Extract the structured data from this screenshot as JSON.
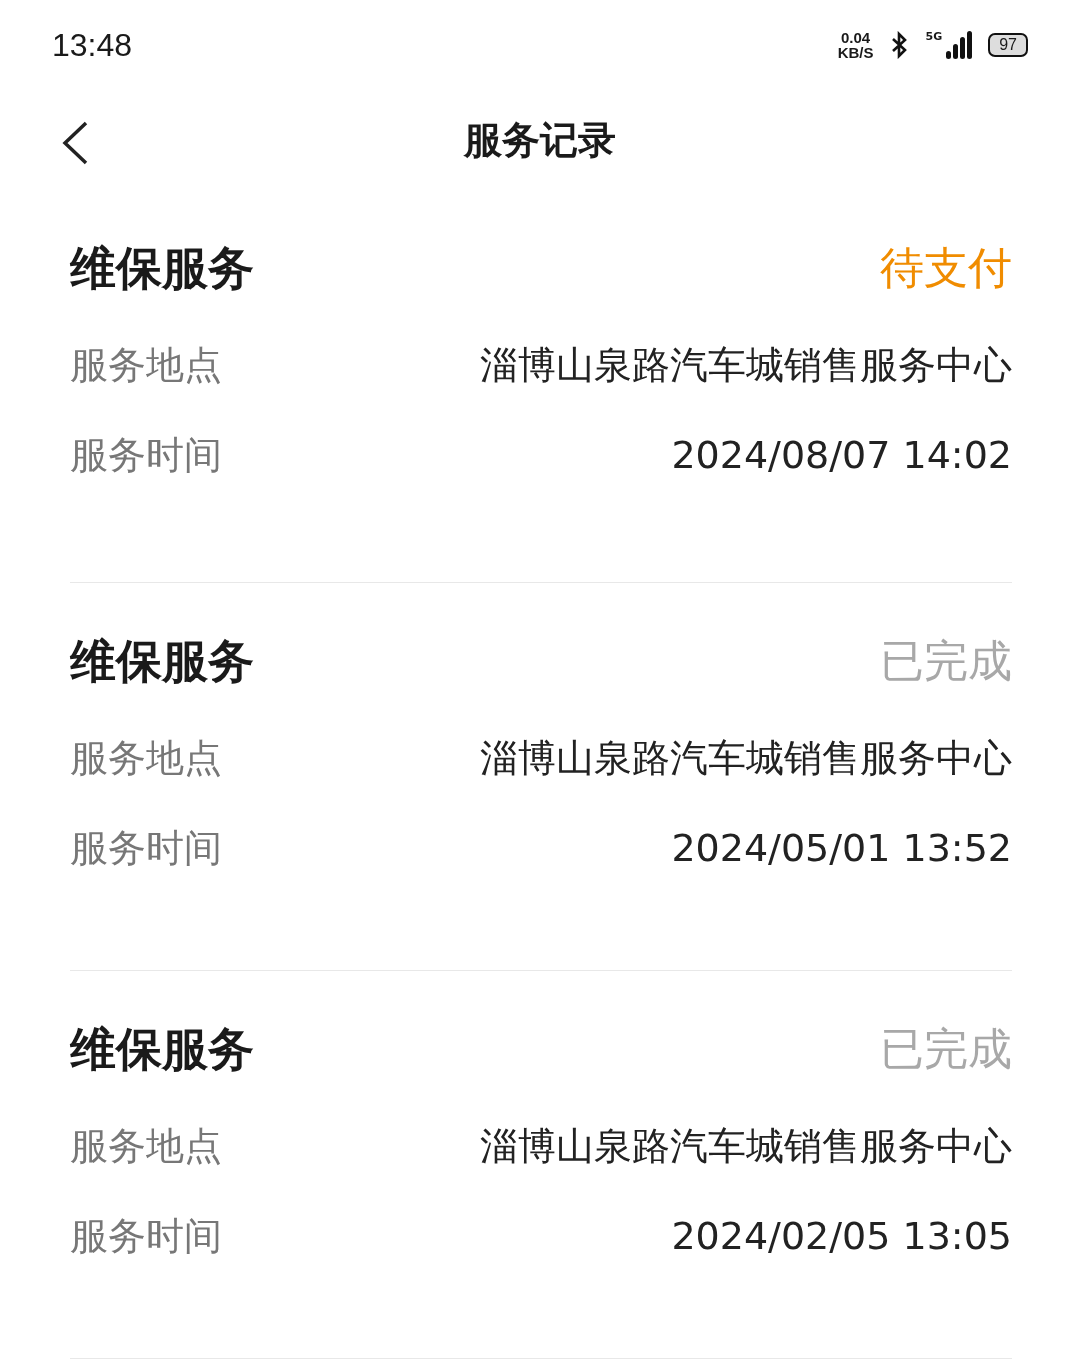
{
  "status_bar": {
    "time": "13:48",
    "speed_value": "0.04",
    "speed_unit": "KB/S",
    "network": "5G",
    "battery": "97"
  },
  "header": {
    "title": "服务记录"
  },
  "records": [
    {
      "title": "维保服务",
      "status": "待支付",
      "kind": "pending",
      "location_label": "服务地点",
      "location": "淄博山泉路汽车城销售服务中心",
      "time_label": "服务时间",
      "time": "2024/08/07 14:02"
    },
    {
      "title": "维保服务",
      "status": "已完成",
      "kind": "done",
      "location_label": "服务地点",
      "location": "淄博山泉路汽车城销售服务中心",
      "time_label": "服务时间",
      "time": "2024/05/01 13:52"
    },
    {
      "title": "维保服务",
      "status": "已完成",
      "kind": "done",
      "location_label": "服务地点",
      "location": "淄博山泉路汽车城销售服务中心",
      "time_label": "服务时间",
      "time": "2024/02/05 13:05"
    }
  ]
}
